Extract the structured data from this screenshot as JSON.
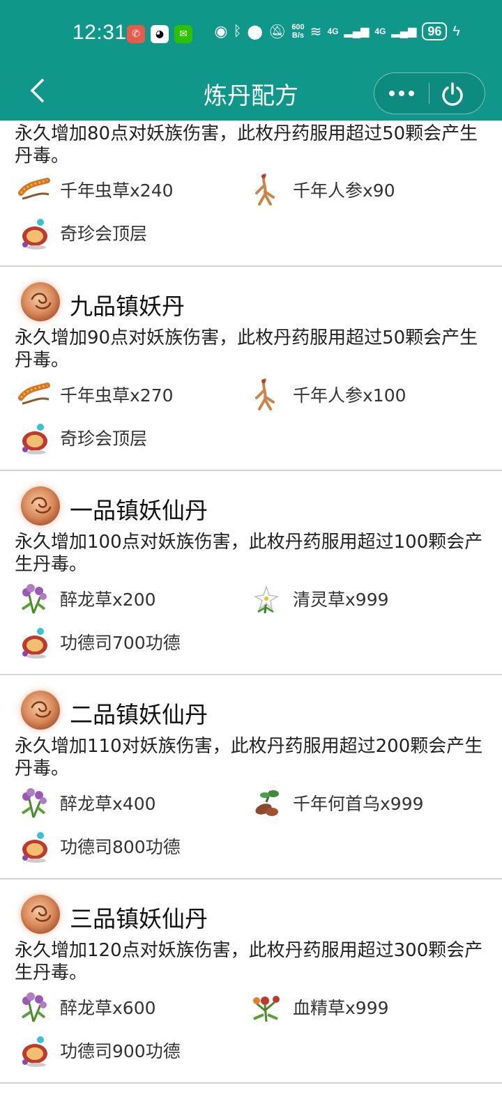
{
  "status": {
    "time": "12:31",
    "net_speed_top": "600",
    "net_speed_bottom": "B/s",
    "sig1": "4G",
    "sig2": "4G",
    "battery": "96"
  },
  "nav": {
    "title": "炼丹配方"
  },
  "top_partial": {
    "desc": "永久增加80点对妖族伤害，此枚丹药服用超过50颗会产生丹毒。",
    "materials": [
      "千年虫草x240",
      "千年人参x90",
      "奇珍会顶层"
    ]
  },
  "cards": [
    {
      "name": "九品镇妖丹",
      "desc": "永久增加90点对妖族伤害，此枚丹药服用超过50颗会产生丹毒。",
      "materials": [
        "千年虫草x270",
        "千年人参x100",
        "奇珍会顶层"
      ]
    },
    {
      "name": "一品镇妖仙丹",
      "desc": "永久增加100点对妖族伤害，此枚丹药服用超过100颗会产生丹毒。",
      "materials": [
        "醉龙草x200",
        "清灵草x999",
        "功德司700功德"
      ]
    },
    {
      "name": "二品镇妖仙丹",
      "desc": "永久增加110对妖族伤害，此枚丹药服用超过200颗会产生丹毒。",
      "materials": [
        "醉龙草x400",
        "千年何首乌x999",
        "功德司800功德"
      ]
    },
    {
      "name": "三品镇妖仙丹",
      "desc": "永久增加120点对妖族伤害，此枚丹药服用超过300颗会产生丹毒。",
      "materials": [
        "醉龙草x600",
        "血精草x999",
        "功德司900功德"
      ]
    }
  ],
  "icons": {
    "caterpillar": "caterpillar-fungus-icon",
    "ginseng": "ginseng-icon",
    "treasure": "treasure-pavilion-icon",
    "lavender": "zuilong-herb-icon",
    "flower": "qingling-herb-icon",
    "heshouwu": "heshouwu-icon",
    "blood": "xuejing-herb-icon"
  },
  "colors": {
    "header": "#0f978a"
  }
}
